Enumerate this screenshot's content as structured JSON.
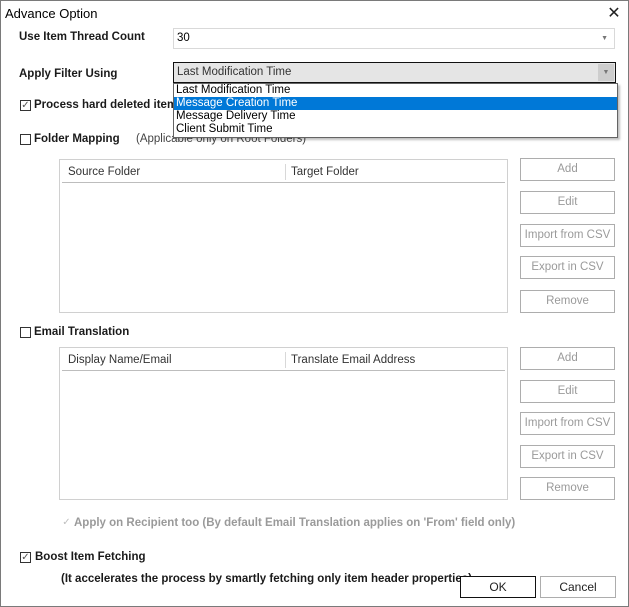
{
  "window": {
    "title": "Advance Option",
    "close_icon": "close-icon"
  },
  "thread_count": {
    "label": "Use Item Thread Count",
    "value": "30"
  },
  "filter": {
    "label": "Apply Filter Using",
    "value": "Last Modification Time",
    "options": [
      {
        "label": "Last Modification Time",
        "selected": false
      },
      {
        "label": "Message Creation Time",
        "selected": true
      },
      {
        "label": "Message Delivery Time",
        "selected": false
      },
      {
        "label": "Client Submit Time",
        "selected": false
      }
    ],
    "highlight_color": "#0078d7"
  },
  "hard_deleted": {
    "label": "Process hard deleted items",
    "checked": true
  },
  "folder_mapping": {
    "label": "Folder Mapping",
    "note": "(Applicable only on Root Folders)",
    "checked": false,
    "columns": [
      "Source Folder",
      "Target Folder"
    ],
    "rows": [],
    "buttons": [
      "Add",
      "Edit",
      "Import from CSV",
      "Export in CSV",
      "Remove"
    ]
  },
  "email_translation": {
    "label": "Email Translation",
    "checked": false,
    "columns": [
      "Display Name/Email",
      "Translate Email Address"
    ],
    "rows": [],
    "buttons": [
      "Add",
      "Edit",
      "Import from CSV",
      "Export in CSV",
      "Remove"
    ],
    "apply_recipient": {
      "label": "Apply on Recipient too (By default Email Translation applies on 'From' field only)",
      "checked": true,
      "disabled": true
    }
  },
  "boost": {
    "label": "Boost Item Fetching",
    "checked": true,
    "note": "(It accelerates the process by smartly fetching only item header properties)"
  },
  "footer": {
    "ok": "OK",
    "cancel": "Cancel"
  }
}
